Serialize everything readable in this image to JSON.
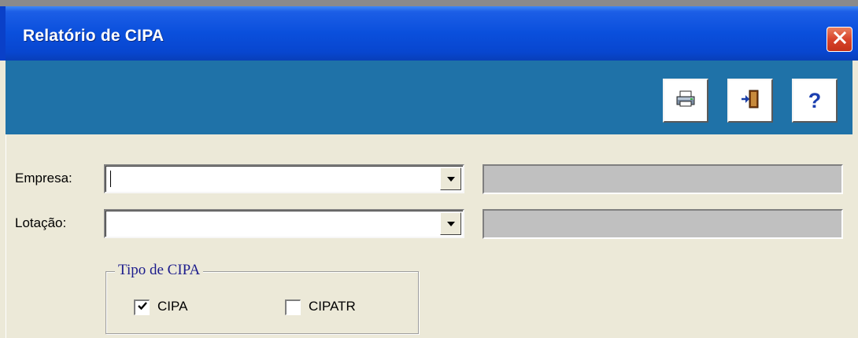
{
  "window": {
    "title": "Relatório de CIPA"
  },
  "toolbar": {
    "buttons": [
      {
        "name": "print",
        "icon": "printer-icon"
      },
      {
        "name": "exit",
        "icon": "exit-door-icon"
      },
      {
        "name": "help",
        "icon": "question-mark-icon",
        "glyph": "?"
      }
    ]
  },
  "form": {
    "empresa_label": "Empresa:",
    "empresa_value": "",
    "empresa_description": "",
    "lotacao_label": "Lotação:",
    "lotacao_value": "",
    "lotacao_description": ""
  },
  "tipo_cipa": {
    "legend": "Tipo de CIPA",
    "options": [
      {
        "label": "CIPA",
        "checked": true
      },
      {
        "label": "CIPATR",
        "checked": false
      }
    ]
  },
  "colors": {
    "titlebar": "#0a4fdc",
    "toolbar": "#1f72a8",
    "face": "#ece9d8",
    "close": "#d8442b",
    "legend_text": "#1c1c8c"
  }
}
